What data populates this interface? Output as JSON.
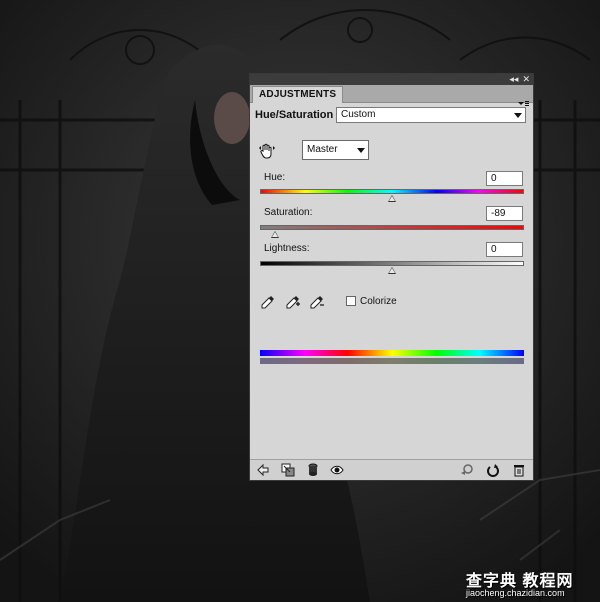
{
  "panel": {
    "tab_label": "ADJUSTMENTS",
    "title_controls": [
      "◂◂",
      "✕"
    ],
    "adjustment_title": "Hue/Saturation",
    "preset_value": "Custom",
    "channel_value": "Master",
    "hue": {
      "label": "Hue:",
      "value": "0",
      "level": 0.5
    },
    "saturation": {
      "label": "Saturation:",
      "value": "-89",
      "level": 0.055
    },
    "lightness": {
      "label": "Lightness:",
      "value": "0",
      "level": 0.5
    },
    "colorize_label": "Colorize",
    "colorize_checked": false
  },
  "icons": {
    "hand": "on-image-adjustment-icon",
    "eyedroppers": [
      "eyedropper-icon",
      "eyedropper-plus-icon",
      "eyedropper-minus-icon"
    ],
    "footer_left": [
      "back-arrow-icon",
      "clip-to-layer-icon",
      "layer-visibility-mask-icon",
      "eye-icon"
    ],
    "footer_right": [
      "view-previous-state-icon",
      "reset-icon",
      "trash-icon"
    ]
  },
  "watermark": {
    "main": "查字典 教程网",
    "sub": "jiaocheng.chazidian.com"
  },
  "colors": {
    "panel_bg": "#d6d6d6",
    "titlebar": "#3c3c3c",
    "background": "#1a1a1a"
  }
}
